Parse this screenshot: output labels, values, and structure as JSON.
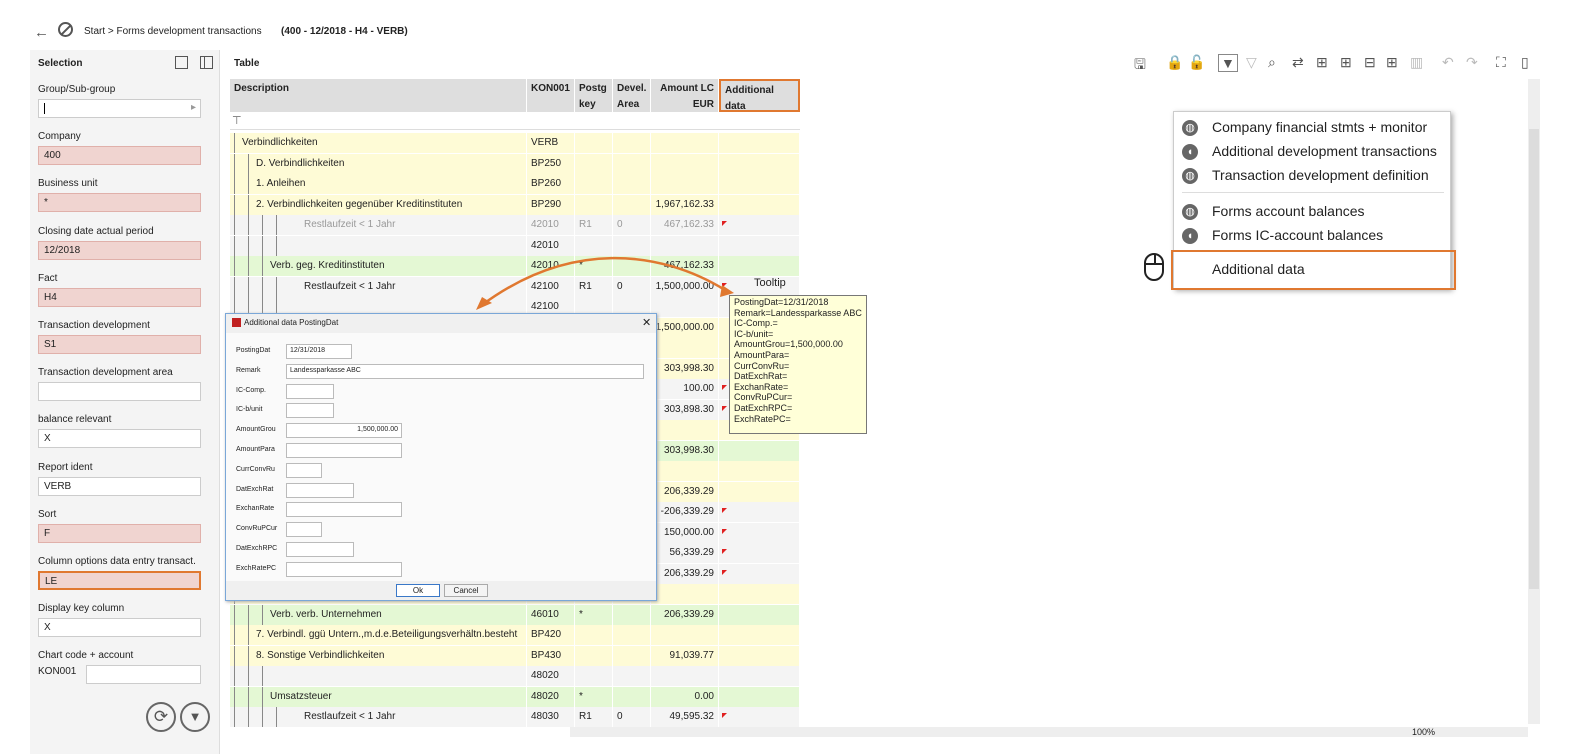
{
  "header": {
    "breadcrumb": "Start > Forms development transactions",
    "context": "(400 - 12/2018 - H4 - VERB)"
  },
  "selection": {
    "title": "Selection",
    "fields": [
      {
        "label": "Group/Sub-group",
        "value": ""
      },
      {
        "label": "Company",
        "value": "400"
      },
      {
        "label": "Business unit",
        "value": "*"
      },
      {
        "label": "Closing date actual period",
        "value": "12/2018"
      },
      {
        "label": "Fact",
        "value": "H4"
      },
      {
        "label": "Transaction development",
        "value": "S1"
      },
      {
        "label": "Transaction development area",
        "value": ""
      },
      {
        "label": "balance relevant",
        "value": "X"
      },
      {
        "label": "Report ident",
        "value": "VERB"
      },
      {
        "label": "Sort",
        "value": "F"
      },
      {
        "label": "Column options data entry transact.",
        "value": "LE"
      },
      {
        "label": "Display key column",
        "value": "X"
      },
      {
        "label": "Chart code + account",
        "value": "KON001"
      }
    ]
  },
  "table": {
    "title": "Table",
    "columns": [
      "Description",
      "KON001",
      "Postg key",
      "Devel. Area",
      "Amount LC EUR",
      "Additional data"
    ],
    "rows": [
      {
        "desc": "Verbindlichkeiten",
        "kon": "VERB",
        "pk": "",
        "da": "",
        "amt": "",
        "flag": false
      },
      {
        "desc": "D. Verbindlichkeiten",
        "kon": "BP250",
        "pk": "",
        "da": "",
        "amt": "",
        "flag": false
      },
      {
        "desc": "1. Anleihen",
        "kon": "BP260",
        "pk": "",
        "da": "",
        "amt": "",
        "flag": false
      },
      {
        "desc": "2. Verbindlichkeiten gegenüber Kreditinstituten",
        "kon": "BP290",
        "pk": "",
        "da": "",
        "amt": "1,967,162.33",
        "flag": false
      },
      {
        "desc": "Restlaufzeit < 1 Jahr",
        "kon": "42010",
        "pk": "R1",
        "da": "0",
        "amt": "467,162.33",
        "flag": true
      },
      {
        "desc": "",
        "kon": "42010",
        "pk": "",
        "da": "",
        "amt": "",
        "flag": false
      },
      {
        "desc": "Verb. geg. Kreditinstituten",
        "kon": "42010",
        "pk": "*",
        "da": "",
        "amt": "467,162.33",
        "flag": false
      },
      {
        "desc": "Restlaufzeit < 1 Jahr",
        "kon": "42100",
        "pk": "R1",
        "da": "0",
        "amt": "1,500,000.00",
        "flag": true
      },
      {
        "desc": "",
        "kon": "42100",
        "pk": "",
        "da": "",
        "amt": "",
        "flag": false
      },
      {
        "desc": "",
        "kon": "",
        "pk": "",
        "da": "",
        "amt": "1,500,000.00",
        "flag": false
      },
      {
        "desc": "",
        "kon": "",
        "pk": "",
        "da": "",
        "amt": "",
        "flag": false
      },
      {
        "desc": "",
        "kon": "",
        "pk": "",
        "da": "",
        "amt": "303,998.30",
        "flag": false
      },
      {
        "desc": "",
        "kon": "",
        "pk": "",
        "da": "",
        "amt": "100.00",
        "flag": true
      },
      {
        "desc": "",
        "kon": "",
        "pk": "",
        "da": "",
        "amt": "303,898.30",
        "flag": true
      },
      {
        "desc": "",
        "kon": "",
        "pk": "",
        "da": "",
        "amt": "",
        "flag": false
      },
      {
        "desc": "",
        "kon": "",
        "pk": "",
        "da": "",
        "amt": "303,998.30",
        "flag": false
      },
      {
        "desc": "",
        "kon": "",
        "pk": "",
        "da": "",
        "amt": "",
        "flag": false
      },
      {
        "desc": "",
        "kon": "",
        "pk": "",
        "da": "",
        "amt": "206,339.29",
        "flag": false
      },
      {
        "desc": "",
        "kon": "",
        "pk": "",
        "da": "",
        "amt": "-206,339.29",
        "flag": true
      },
      {
        "desc": "",
        "kon": "",
        "pk": "",
        "da": "",
        "amt": "150,000.00",
        "flag": true
      },
      {
        "desc": "",
        "kon": "",
        "pk": "",
        "da": "",
        "amt": "56,339.29",
        "flag": true
      },
      {
        "desc": "",
        "kon": "",
        "pk": "",
        "da": "",
        "amt": "206,339.29",
        "flag": true
      },
      {
        "desc": "",
        "kon": "",
        "pk": "",
        "da": "",
        "amt": "",
        "flag": false
      },
      {
        "desc": "Verb. verb. Unternehmen",
        "kon": "46010",
        "pk": "*",
        "da": "",
        "amt": "206,339.29",
        "flag": false
      },
      {
        "desc": "7. Verbindl. ggü Untern.,m.d.e.Beteiligungsverhältn.besteht",
        "kon": "BP420",
        "pk": "",
        "da": "",
        "amt": "",
        "flag": false
      },
      {
        "desc": "8. Sonstige Verbindlichkeiten",
        "kon": "BP430",
        "pk": "",
        "da": "",
        "amt": "91,039.77",
        "flag": false
      },
      {
        "desc": "",
        "kon": "48020",
        "pk": "",
        "da": "",
        "amt": "",
        "flag": false
      },
      {
        "desc": "Umsatzsteuer",
        "kon": "48020",
        "pk": "*",
        "da": "",
        "amt": "0.00",
        "flag": false
      },
      {
        "desc": "Restlaufzeit < 1 Jahr",
        "kon": "48030",
        "pk": "R1",
        "da": "0",
        "amt": "49,595.32",
        "flag": true
      }
    ]
  },
  "dialog": {
    "title": "Additional data PostingDat",
    "fields": [
      {
        "label": "PostingDat",
        "value": "12/31/2018"
      },
      {
        "label": "Remark",
        "value": "Landessparkasse ABC"
      },
      {
        "label": "IC-Comp.",
        "value": ""
      },
      {
        "label": "IC-b/unit",
        "value": ""
      },
      {
        "label": "AmountGrou",
        "value": "1,500,000.00"
      },
      {
        "label": "AmountPara",
        "value": ""
      },
      {
        "label": "CurrConvRu",
        "value": ""
      },
      {
        "label": "DatExchRat",
        "value": ""
      },
      {
        "label": "ExchanRate",
        "value": ""
      },
      {
        "label": "ConvRuPCur",
        "value": ""
      },
      {
        "label": "DatExchRPC",
        "value": ""
      },
      {
        "label": "ExchRatePC",
        "value": ""
      }
    ],
    "ok_label": "Ok",
    "cancel_label": "Cancel"
  },
  "tooltip": {
    "label": "Tooltip",
    "lines": [
      "PostingDat=12/31/2018",
      "Remark=Landessparkasse ABC",
      "IC-Comp.=",
      "IC-b/unit=",
      "AmountGrou=1,500,000.00",
      "AmountPara=",
      "CurrConvRu=",
      "DatExchRat=",
      "ExchanRate=",
      "ConvRuPCur=",
      "DatExchRPC=",
      "ExchRatePC="
    ]
  },
  "context_menu": {
    "items": [
      {
        "label": "Company financial stmts + monitor",
        "icon": "globe-icon"
      },
      {
        "label": "Additional development transactions",
        "icon": "bookmark-icon"
      },
      {
        "label": "Transaction development definition",
        "icon": "globe-icon"
      },
      {
        "label": "Forms account balances",
        "icon": "globe-icon"
      },
      {
        "label": "Forms IC-account balances",
        "icon": "bookmark-icon"
      },
      {
        "label": "Additional data",
        "icon": ""
      }
    ]
  },
  "zoom": "100%",
  "colors": {
    "highlight": "#e07830",
    "pink": "#f0d4d0",
    "yellow": "#fefbd6",
    "green": "#e4f8d4"
  }
}
